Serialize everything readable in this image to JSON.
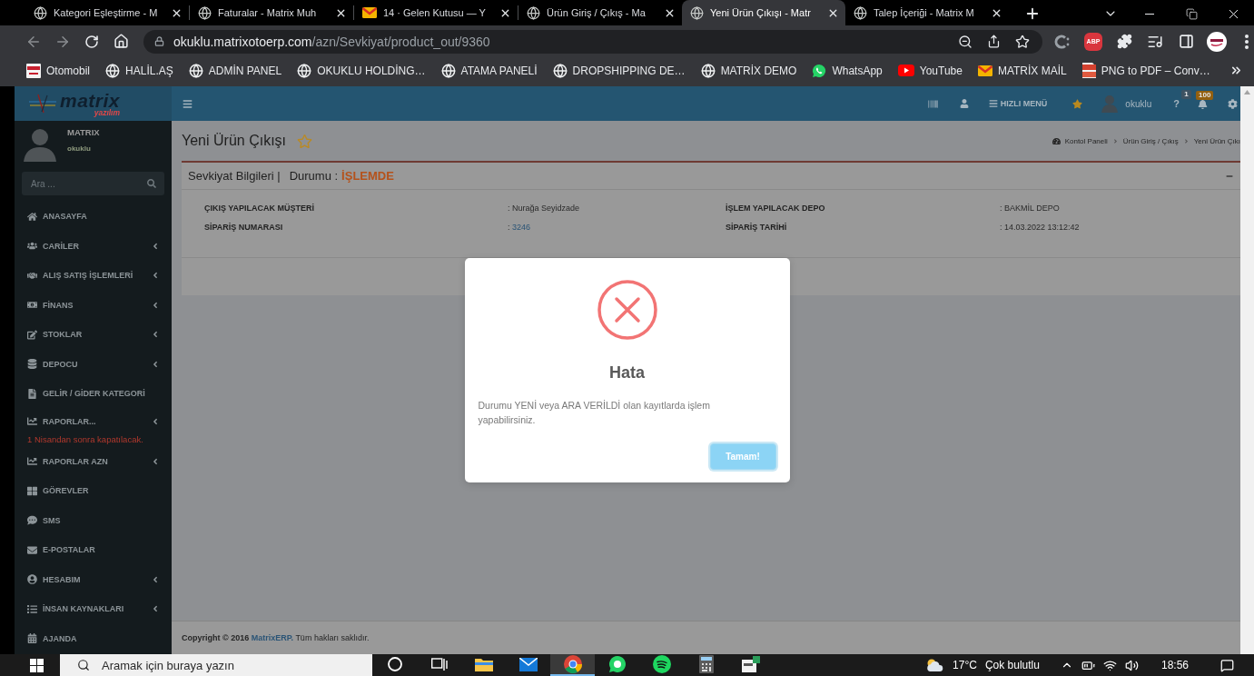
{
  "browser": {
    "tabs": [
      {
        "title": "Kategori Eşleştirme - M",
        "kind": "globe",
        "selected": false
      },
      {
        "title": "Faturalar - Matrix Muh",
        "kind": "globe",
        "selected": false
      },
      {
        "title": "14 · Gelen Kutusu — Y",
        "kind": "mail",
        "selected": false
      },
      {
        "title": "Ürün Giriş / Çıkış - Ma",
        "kind": "globe",
        "selected": false
      },
      {
        "title": "Yeni Ürün Çıkışı - Matr",
        "kind": "globe",
        "selected": true
      },
      {
        "title": "Talep İçeriği - Matrix M",
        "kind": "globe",
        "selected": false
      }
    ],
    "back_enabled": false,
    "forward_enabled": false,
    "address": {
      "host": "okuklu.matrixotoerp.com",
      "path": "/azn/Sevkiyat/product_out/9360"
    },
    "abp_label": "ABP",
    "bookmarks": [
      {
        "label": "Otomobil",
        "kind": "tile"
      },
      {
        "label": "HALİL.AŞ",
        "kind": "globe"
      },
      {
        "label": "ADMİN PANEL",
        "kind": "globe"
      },
      {
        "label": "OKUKLU HOLDİNG…",
        "kind": "globe"
      },
      {
        "label": "ATAMA PANELİ",
        "kind": "globe"
      },
      {
        "label": "DROPSHIPPING DE…",
        "kind": "globe"
      },
      {
        "label": "MATRİX DEMO",
        "kind": "globe"
      },
      {
        "label": "WhatsApp",
        "kind": "chat"
      },
      {
        "label": "YouTube",
        "kind": "video"
      },
      {
        "label": "MATRİX MAİL",
        "kind": "mail"
      },
      {
        "label": "PNG to PDF – Conv…",
        "kind": "document"
      }
    ]
  },
  "app": {
    "logo": {
      "name": "matrix",
      "tagline": "yazılım"
    },
    "header": {
      "quick_menu": "HIZLI MENÜ",
      "user": "okuklu",
      "help": "?",
      "help_badge": "1",
      "notification_badge": "100"
    },
    "sidebar": {
      "user_name": "MATRIX",
      "user_login": "okuklu",
      "search_placeholder": "Ara ...",
      "items": [
        {
          "label": "ANASAYFA",
          "has_submenu": false
        },
        {
          "label": "CARİLER",
          "has_submenu": true
        },
        {
          "label": "ALIŞ SATIŞ İŞLEMLERİ",
          "has_submenu": true
        },
        {
          "label": "FİNANS",
          "has_submenu": true
        },
        {
          "label": "STOKLAR",
          "has_submenu": true
        },
        {
          "label": "DEPOCU",
          "has_submenu": true
        },
        {
          "label": "GELİR / GİDER KATEGORİ",
          "has_submenu": false
        },
        {
          "label": "RAPORLAR...",
          "has_submenu": true,
          "note": "1 Nisandan sonra kapatılacak."
        },
        {
          "label": "RAPORLAR AZN",
          "has_submenu": true
        },
        {
          "label": "GÖREVLER",
          "has_submenu": false
        },
        {
          "label": "SMS",
          "has_submenu": false
        },
        {
          "label": "E-POSTALAR",
          "has_submenu": false
        },
        {
          "label": "HESABIM",
          "has_submenu": true
        },
        {
          "label": "İNSAN KAYNAKLARI",
          "has_submenu": true
        },
        {
          "label": "AJANDA",
          "has_submenu": false
        }
      ]
    },
    "page": {
      "title": "Yeni Ürün Çıkışı",
      "favorite": false,
      "breadcrumb": [
        "Kontol Paneli",
        "Ürün Giriş / Çıkış",
        "Yeni Ürün Çıkı"
      ]
    },
    "shipment": {
      "title": "Sevkiyat Bilgileri |",
      "status_label": "Durumu :",
      "status": "İŞLEMDE",
      "fields": [
        {
          "label": "ÇIKIŞ YAPILACAK MÜŞTERİ",
          "separator": ":",
          "value": "Nurağa Seyidzade",
          "kind": "text"
        },
        {
          "label": "İŞLEM YAPILACAK DEPO",
          "separator": ":",
          "value": "BAKMİL DEPO",
          "kind": "text"
        },
        {
          "label": "SİPARİŞ NUMARASI",
          "separator": ":",
          "value": "3246",
          "kind": "link"
        },
        {
          "label": "SİPARİŞ TARİHİ",
          "separator": ":",
          "value": "14.03.2022 13:12:42",
          "kind": "text"
        }
      ]
    },
    "footer": {
      "copyright": "Copyright © 2016",
      "link": "MatrixERP.",
      "rights": "Tüm hakları saklıdır."
    }
  },
  "dialog": {
    "kind": "error",
    "title": "Hata",
    "message": "Durumu YENİ veya ARA VERİLDİ olan kayıtlarda işlem yapabilirsiniz.",
    "button": "Tamam!"
  },
  "taskbar": {
    "search_placeholder": "Aramak için buraya yazın",
    "apps": [
      {
        "kind": "cortana",
        "active": false
      },
      {
        "kind": "taskview",
        "active": false
      },
      {
        "kind": "explorer",
        "active": false
      },
      {
        "kind": "mail",
        "active": false
      },
      {
        "kind": "chrome",
        "active": true
      },
      {
        "kind": "whatsapp",
        "active": false
      },
      {
        "kind": "spotify",
        "active": false
      },
      {
        "kind": "calculator",
        "active": false
      },
      {
        "kind": "app",
        "active": false
      }
    ],
    "temperature": "17°C",
    "weather": "Çok bulutlu",
    "time": "18:56"
  }
}
